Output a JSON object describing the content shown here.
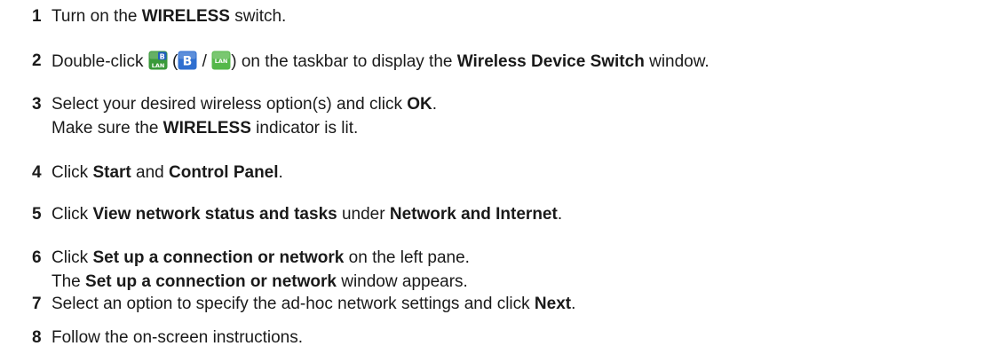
{
  "steps": [
    {
      "number": "1",
      "lines": [
        [
          {
            "t": "Turn on the "
          },
          {
            "t": "WIRELESS",
            "b": true
          },
          {
            "t": " switch."
          }
        ]
      ]
    },
    {
      "number": "2",
      "lines": [
        [
          {
            "t": "Double-click "
          },
          {
            "icon": "wireless-switch-icon"
          },
          {
            "t": " ("
          },
          {
            "icon": "bluetooth-icon"
          },
          {
            "t": " / "
          },
          {
            "icon": "wireless-lan-icon"
          },
          {
            "t": ") on the taskbar to display the "
          },
          {
            "t": "Wireless Device Switch",
            "b": true
          },
          {
            "t": " window."
          }
        ]
      ]
    },
    {
      "number": "3",
      "lines": [
        [
          {
            "t": "Select your desired wireless option(s) and click "
          },
          {
            "t": "OK",
            "b": true
          },
          {
            "t": "."
          }
        ],
        [
          {
            "t": "Make sure the "
          },
          {
            "t": "WIRELESS",
            "b": true
          },
          {
            "t": " indicator is lit."
          }
        ]
      ]
    },
    {
      "number": "4",
      "lines": [
        [
          {
            "t": "Click "
          },
          {
            "t": "Start",
            "b": true
          },
          {
            "t": " and "
          },
          {
            "t": "Control Panel",
            "b": true
          },
          {
            "t": "."
          }
        ]
      ]
    },
    {
      "number": "5",
      "lines": [
        [
          {
            "t": "Click "
          },
          {
            "t": "View network status and tasks",
            "b": true
          },
          {
            "t": " under "
          },
          {
            "t": "Network and Internet",
            "b": true
          },
          {
            "t": "."
          }
        ]
      ]
    },
    {
      "number": "6",
      "lines": [
        [
          {
            "t": "Click "
          },
          {
            "t": "Set up a connection or network",
            "b": true
          },
          {
            "t": " on the left pane."
          }
        ],
        [
          {
            "t": "The "
          },
          {
            "t": "Set up a connection or network",
            "b": true
          },
          {
            "t": " window appears."
          }
        ]
      ]
    },
    {
      "number": "7",
      "lines": [
        [
          {
            "t": "Select an option to specify the ad-hoc network settings and click "
          },
          {
            "t": "Next",
            "b": true
          },
          {
            "t": "."
          }
        ]
      ]
    },
    {
      "number": "8",
      "lines": [
        [
          {
            "t": "Follow the on-screen instructions."
          }
        ]
      ]
    }
  ],
  "icons": {
    "wireless-switch-icon": {
      "glyph_top": "B",
      "glyph_bottom": "LAN",
      "color": "#3a9a3a",
      "accent": "#1f5fbf"
    },
    "bluetooth-icon": {
      "glyph": "B",
      "color": "#2f6fd0"
    },
    "wireless-lan-icon": {
      "glyph": "LAN",
      "color": "#55b84a"
    }
  }
}
